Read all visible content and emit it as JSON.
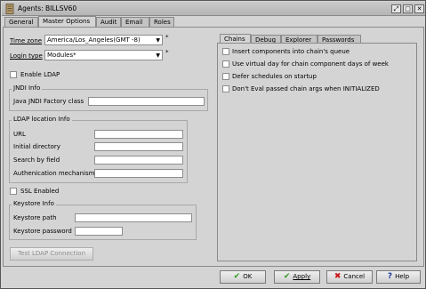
{
  "window": {
    "title": "Agents: BILLSV60",
    "buttons": {
      "restore": "⤢",
      "maximize": "□",
      "close": "✕"
    }
  },
  "tabs": [
    {
      "label": "General"
    },
    {
      "label": "Master Options"
    },
    {
      "label": "Audit"
    },
    {
      "label": "Email"
    },
    {
      "label": "Roles"
    }
  ],
  "main": {
    "time_zone": {
      "label": "Time zone",
      "value": "America/Los_Angeles(GMT -8)"
    },
    "login_type": {
      "label": "Login type",
      "value": "Modules*"
    },
    "required_marker": "*",
    "enable_ldap": {
      "label": "Enable LDAP",
      "checked": false
    },
    "jndi": {
      "title": "JNDI Info",
      "factory_class": {
        "label": "Java JNDI Factory class",
        "value": ""
      }
    },
    "ldap_location": {
      "title": "LDAP location Info",
      "url": {
        "label": "URL",
        "value": ""
      },
      "initial_directory": {
        "label": "Initial directory",
        "value": ""
      },
      "search_by_field": {
        "label": "Search by field",
        "value": ""
      },
      "auth_mechanism": {
        "label": "Authenication mechanism",
        "value": ""
      }
    },
    "ssl_enabled": {
      "label": "SSL Enabled",
      "checked": false
    },
    "keystore": {
      "title": "Keystore Info",
      "path": {
        "label": "Keystore path",
        "value": ""
      },
      "password": {
        "label": "Keystore password",
        "value": ""
      }
    },
    "test_ldap_button": "Test LDAP Connection"
  },
  "right_tabs": [
    {
      "label": "Chains"
    },
    {
      "label": "Debug"
    },
    {
      "label": "Explorer"
    },
    {
      "label": "Passwords"
    }
  ],
  "chains": {
    "options": [
      {
        "label": "Insert components into chain's queue",
        "checked": false
      },
      {
        "label": "Use virtual day for chain component days of week",
        "checked": false
      },
      {
        "label": "Defer schedules on startup",
        "checked": false
      },
      {
        "label": "Don't Eval passed chain args when INITIALIZED",
        "checked": false
      }
    ]
  },
  "footer": {
    "ok": "OK",
    "apply": "Apply",
    "cancel": "Cancel",
    "help": "Help"
  },
  "colors": {
    "ok_check": "#2e9a1f",
    "cancel_x": "#c81414",
    "help_q": "#1f3d9a"
  }
}
